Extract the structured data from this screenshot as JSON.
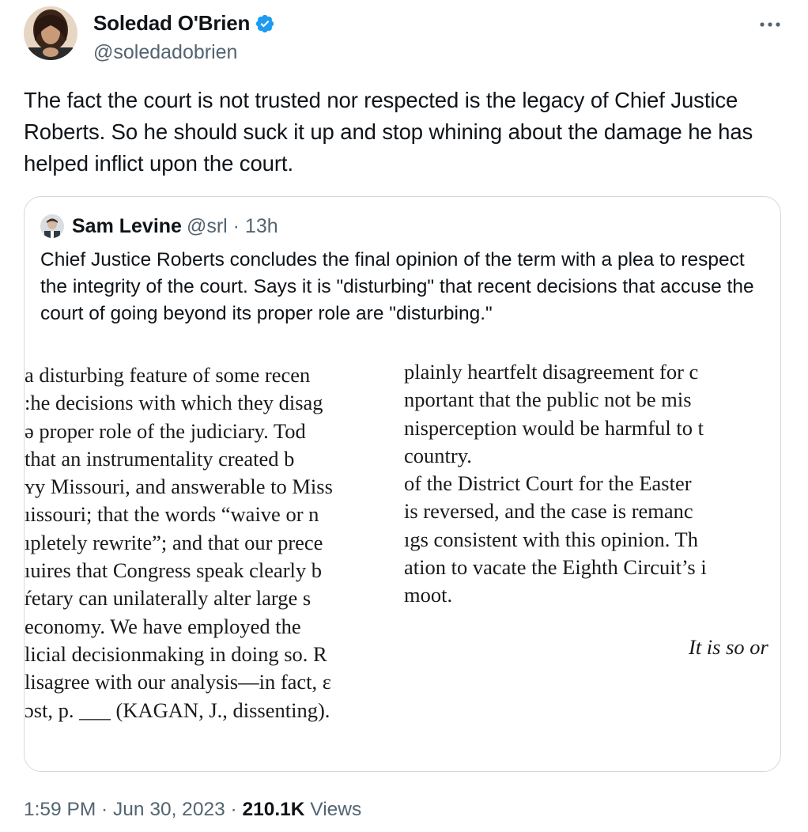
{
  "author": {
    "name": "Soledad O'Brien",
    "handle": "@soledadobrien",
    "verified_icon": "verified-badge-icon",
    "verified_color": "#1d9bf0"
  },
  "tweet": {
    "text": "The fact the court is not trusted nor respected is the legacy of Chief Justice Roberts. So he should suck it up and stop whining about the damage he has helped inflict upon the court."
  },
  "quote": {
    "name": "Sam Levine",
    "handle": "@srl · 13h",
    "text": "Chief Justice Roberts concludes the final opinion of the term with a plea to respect the integrity of the court. Says it is \"disturbing\" that recent decisions that accuse the court of going beyond its proper role are \"disturbing.\"",
    "media": {
      "left_lines": [
        "a disturbing feature of some recen",
        ":he decisions with which they disag",
        "ə proper role of the judiciary.  Tod",
        " that an instrumentality created b",
        "ʏy Missouri, and answerable to Miss",
        "ıissouri; that the words “waive or n",
        "ıpletely rewrite”; and that our prece",
        "ıuires that Congress speak clearly b",
        "ŕetary can unilaterally alter large s",
        " economy.  We have employed the",
        "licial decisionmaking in doing so.  R",
        "lisagree with our analysis—in fact, ɛ",
        "ɔst, p. ___ (KAGAN, J., dissenting)."
      ],
      "right_lines": [
        "plainly heartfelt disagreement for c",
        "nportant that the public not be mis",
        "nisperception would be harmful to t",
        " country.",
        "of the District Court for the Easter",
        "is reversed, and the case is remanc",
        "ıgs consistent with this opinion.  Th",
        "ation to vacate the Eighth Circuit’s i",
        "moot."
      ],
      "closing": "It is so or"
    }
  },
  "meta": {
    "time": "1:59 PM · Jun 30, 2023 · ",
    "views_count": "210.1K",
    "views_label": " Views"
  }
}
